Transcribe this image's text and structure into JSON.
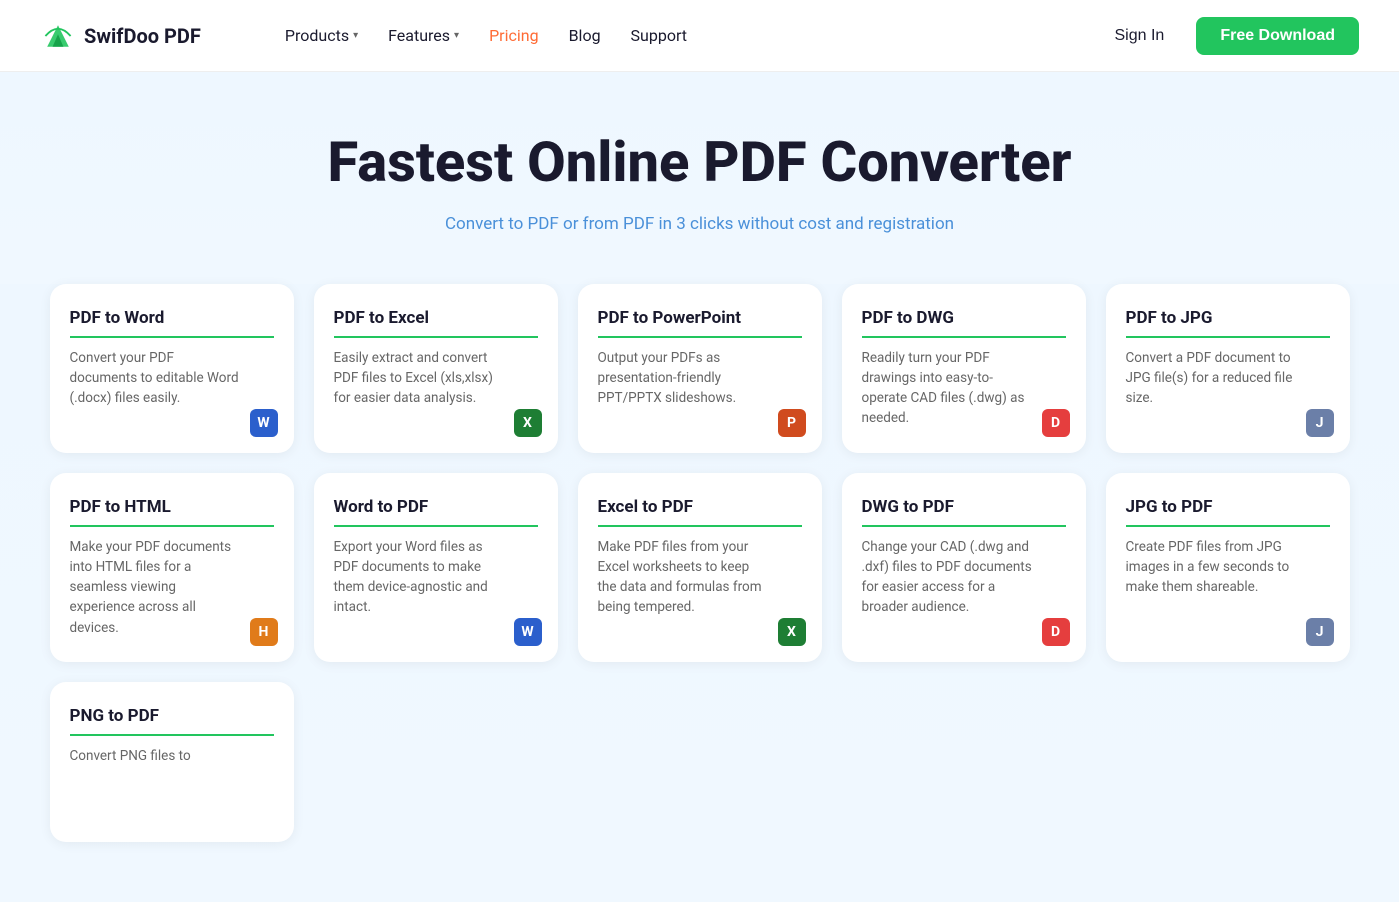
{
  "brand": {
    "name": "SwifDoo PDF"
  },
  "nav": {
    "links": [
      {
        "label": "Products",
        "hasChevron": true,
        "active": false
      },
      {
        "label": "Features",
        "hasChevron": true,
        "active": false
      },
      {
        "label": "Pricing",
        "hasChevron": false,
        "active": true
      },
      {
        "label": "Blog",
        "hasChevron": false,
        "active": false
      },
      {
        "label": "Support",
        "hasChevron": false,
        "active": false
      }
    ],
    "sign_in": "Sign In",
    "free_download": "Free Download"
  },
  "hero": {
    "title": "Fastest Online PDF Converter",
    "subtitle": "Convert to PDF or from PDF in 3 clicks without cost and registration"
  },
  "cards": {
    "row1": [
      {
        "title": "PDF to Word",
        "desc": "Convert your PDF documents to editable Word (.docx) files easily.",
        "icon_label": "W",
        "icon_class": "icon-word"
      },
      {
        "title": "PDF to Excel",
        "desc": "Easily extract and convert PDF files to Excel (xls,xlsx) for easier data analysis.",
        "icon_label": "X",
        "icon_class": "icon-excel"
      },
      {
        "title": "PDF to PowerPoint",
        "desc": "Output your PDFs as presentation-friendly PPT/PPTX slideshows.",
        "icon_label": "P",
        "icon_class": "icon-ppt"
      },
      {
        "title": "PDF to DWG",
        "desc": "Readily turn your PDF drawings into easy-to-operate CAD files (.dwg) as needed.",
        "icon_label": "D",
        "icon_class": "icon-dwg-red"
      },
      {
        "title": "PDF to JPG",
        "desc": "Convert a PDF document to JPG file(s) for a reduced file size.",
        "icon_label": "J",
        "icon_class": "icon-jpg"
      }
    ],
    "row2": [
      {
        "title": "PDF to HTML",
        "desc": "Make your PDF documents into HTML files for a seamless viewing experience across all devices.",
        "icon_label": "H",
        "icon_class": "icon-html"
      },
      {
        "title": "Word to PDF",
        "desc": "Export your Word files as PDF documents to make them device-agnostic and intact.",
        "icon_label": "W",
        "icon_class": "icon-word2"
      },
      {
        "title": "Excel to PDF",
        "desc": "Make PDF files from your Excel worksheets to keep the data and formulas from being tempered.",
        "icon_label": "X",
        "icon_class": "icon-excel2"
      },
      {
        "title": "DWG to PDF",
        "desc": "Change your CAD (.dwg and .dxf) files to PDF documents for easier access for a broader audience.",
        "icon_label": "D",
        "icon_class": "icon-dwg2"
      },
      {
        "title": "JPG to PDF",
        "desc": "Create PDF files from JPG images in a few seconds to make them shareable.",
        "icon_label": "J",
        "icon_class": "icon-jpg2"
      }
    ],
    "row3": [
      {
        "title": "PNG to PDF",
        "desc": "Convert PNG files to",
        "icon_label": "",
        "icon_class": ""
      }
    ]
  }
}
